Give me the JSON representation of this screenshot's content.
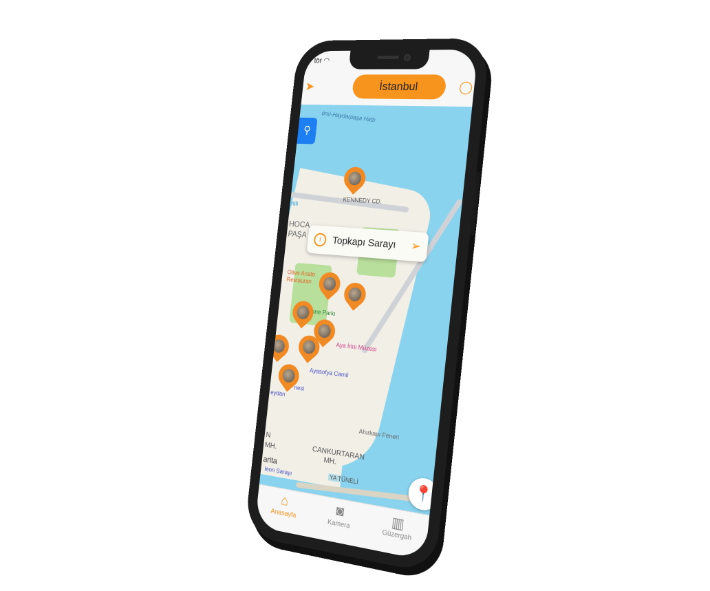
{
  "status": {
    "carrier": "tör"
  },
  "header": {
    "city": "İstanbul"
  },
  "map": {
    "labels": {
      "rail": "önü-Haydarpaşa Hattı",
      "street": "KENNEDY CD.",
      "neighborhood1": "HOCA",
      "neighborhood1b": "PAŞA M",
      "hili": "hili",
      "restaurant1": "Olive Anato",
      "restaurant2": "Restauran",
      "park": "lhane Parkı",
      "museum": "Aya İrini Müzesi",
      "mosque": "Ayasofya Camii",
      "nesi": "nesi",
      "meydan": "eydan",
      "lighthouse": "Ahırkapı Feneri",
      "cankurtaran1": "CANKURTARAN",
      "cankurtaran2": "MH.",
      "n1": "N",
      "n2": "MH.",
      "harita": "arita",
      "saray": "leon Sarayı",
      "tunnel": "YA TÜNELİ"
    },
    "callout": {
      "title": "Topkapı Sarayı"
    }
  },
  "tabs": [
    {
      "label": "Anasayfa"
    },
    {
      "label": "Kamera"
    },
    {
      "label": "Güzergah"
    }
  ],
  "colors": {
    "accent": "#f7941d",
    "water": "#8ad3ee",
    "land": "#f1efe6"
  }
}
